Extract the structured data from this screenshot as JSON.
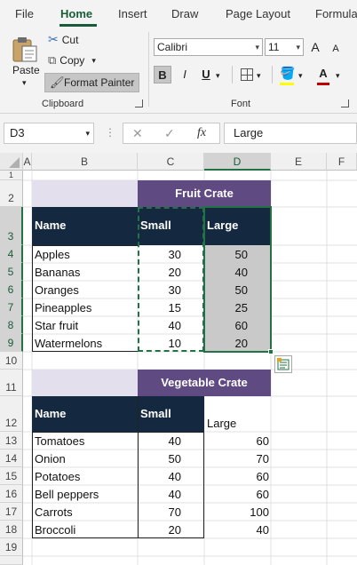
{
  "ribbon_tabs": [
    "File",
    "Home",
    "Insert",
    "Draw",
    "Page Layout",
    "Formula"
  ],
  "clipboard": {
    "paste": "Paste",
    "cut": "Cut",
    "copy": "Copy",
    "format_painter": "Format Painter",
    "group_label": "Clipboard"
  },
  "font": {
    "name": "Calibri",
    "size": "11",
    "group_label": "Font",
    "bold": "B",
    "italic": "I",
    "underline": "U",
    "grow": "A",
    "shrink": "A",
    "color": "A"
  },
  "formula_bar": {
    "name_box": "D3",
    "fx": "fx",
    "value": "Large"
  },
  "columns": [
    "A",
    "B",
    "C",
    "D",
    "E",
    "F"
  ],
  "rows": [
    "1",
    "2",
    "3",
    "4",
    "5",
    "6",
    "7",
    "8",
    "9",
    "10",
    "11",
    "12",
    "13",
    "14",
    "15",
    "16",
    "17",
    "18",
    "19"
  ],
  "fruit_table": {
    "title": "Fruit Crate",
    "header": {
      "name": "Name",
      "small": "Small",
      "large": "Large"
    },
    "rows": [
      {
        "name": "Apples",
        "small": "30",
        "large": "50"
      },
      {
        "name": "Bananas",
        "small": "20",
        "large": "40"
      },
      {
        "name": "Oranges",
        "small": "30",
        "large": "50"
      },
      {
        "name": "Pineapples",
        "small": "15",
        "large": "25"
      },
      {
        "name": "Star fruit",
        "small": "40",
        "large": "60"
      },
      {
        "name": "Watermelons",
        "small": "10",
        "large": "20"
      }
    ]
  },
  "veg_table": {
    "title": "Vegetable Crate",
    "header": {
      "name": "Name",
      "small": "Small",
      "large": "Large"
    },
    "rows": [
      {
        "name": "Tomatoes",
        "small": "40",
        "large": "60"
      },
      {
        "name": "Onion",
        "small": "50",
        "large": "70"
      },
      {
        "name": "Potatoes",
        "small": "40",
        "large": "60"
      },
      {
        "name": "Bell peppers",
        "small": "40",
        "large": "60"
      },
      {
        "name": "Carrots",
        "small": "70",
        "large": "100"
      },
      {
        "name": "Broccoli",
        "small": "20",
        "large": "40"
      }
    ]
  },
  "colors": {
    "accent_green": "#185c37",
    "header_dark": "#142840",
    "title_purple": "#5f4a82",
    "lavender": "#e4dfec",
    "selection_grey": "#c9c9c9"
  }
}
